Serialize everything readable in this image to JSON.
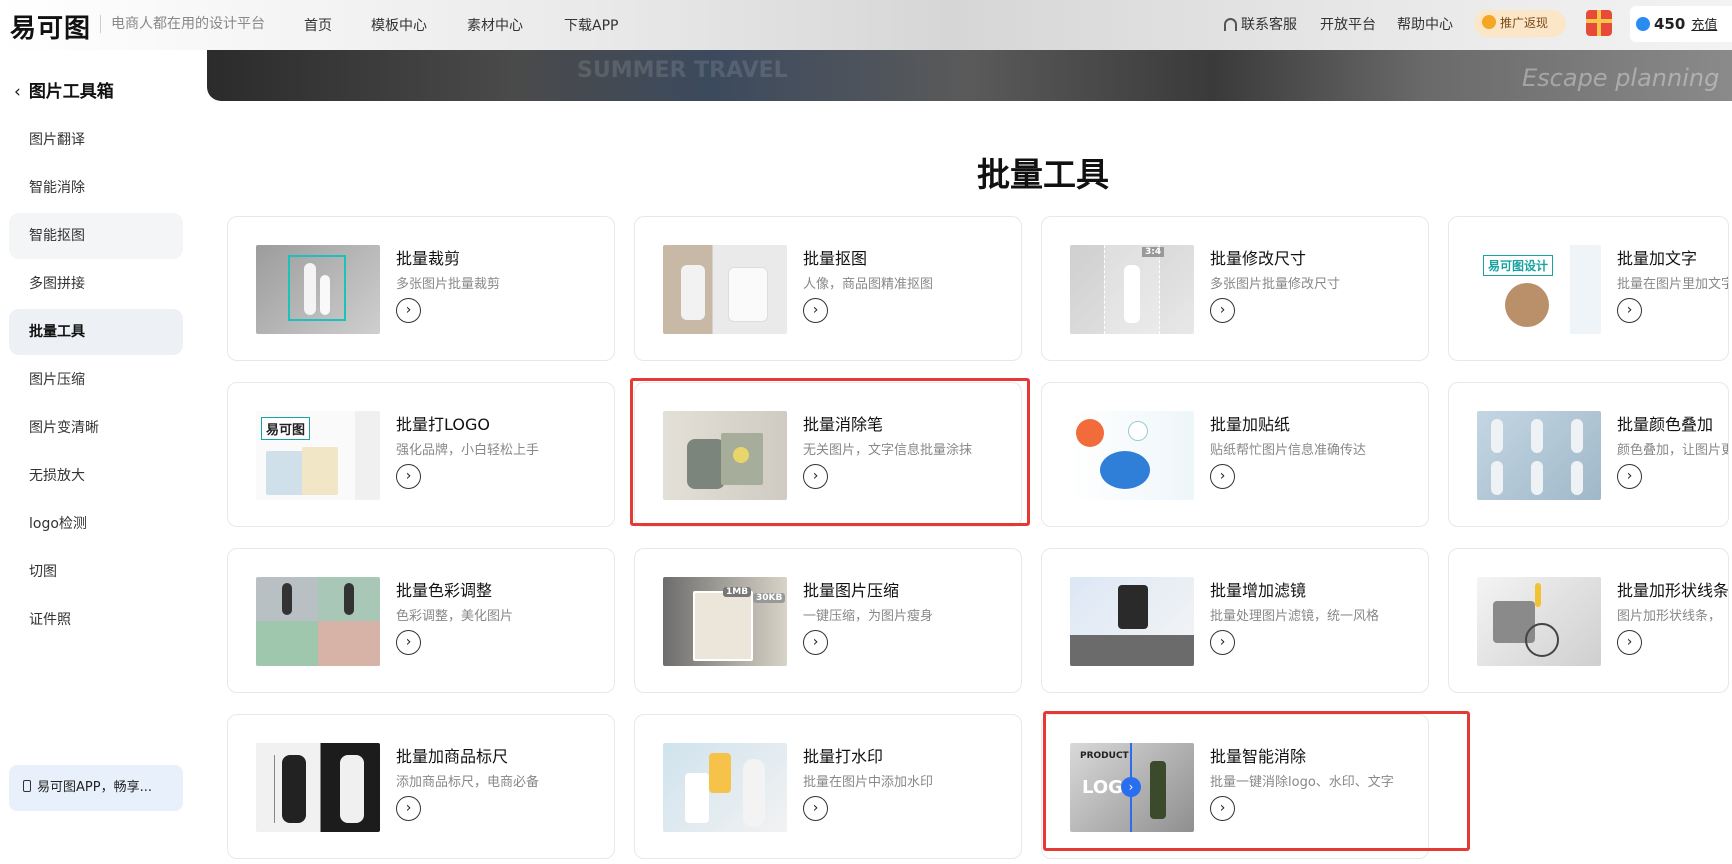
{
  "header": {
    "logo": "易可图",
    "slogan": "电商人都在用的设计平台",
    "nav": [
      "首页",
      "模板中心",
      "素材中心",
      "下载APP"
    ],
    "service": "联系客服",
    "open_platform": "开放平台",
    "help": "帮助中心",
    "promo": "推广返现",
    "balance": "450",
    "recharge": "充值"
  },
  "banner": {
    "texts": [
      "SUMMER TRAVEL",
      "Escape planning"
    ]
  },
  "sidebar": {
    "title": "图片工具箱",
    "items": [
      "图片翻译",
      "智能消除",
      "智能抠图",
      "多图拼接",
      "批量工具",
      "图片压缩",
      "图片变清晰",
      "无损放大",
      "logo检测",
      "切图",
      "证件照"
    ],
    "active_index": 4,
    "hover_index": 2,
    "app_promo": "易可图APP，畅享..."
  },
  "main": {
    "heading": "批量工具",
    "tools": [
      {
        "title": "批量裁剪",
        "desc": "多张图片批量裁剪",
        "highlighted": false
      },
      {
        "title": "批量抠图",
        "desc": "人像，商品图精准抠图",
        "highlighted": false
      },
      {
        "title": "批量修改尺寸",
        "desc": "多张图片批量修改尺寸",
        "highlighted": false
      },
      {
        "title": "批量加文字",
        "desc": "批量在图片里加文字",
        "highlighted": false
      },
      {
        "title": "批量打LOGO",
        "desc": "强化品牌，小白轻松上手",
        "highlighted": false
      },
      {
        "title": "批量消除笔",
        "desc": "无关图片，文字信息批量涂抹",
        "highlighted": true
      },
      {
        "title": "批量加贴纸",
        "desc": "贴纸帮忙图片信息准确传达",
        "highlighted": false
      },
      {
        "title": "批量颜色叠加",
        "desc": "颜色叠加，让图片更",
        "highlighted": false
      },
      {
        "title": "批量色彩调整",
        "desc": "色彩调整，美化图片",
        "highlighted": false
      },
      {
        "title": "批量图片压缩",
        "desc": "一键压缩，为图片瘦身",
        "highlighted": false
      },
      {
        "title": "批量增加滤镜",
        "desc": "批量处理图片滤镜，统一风格",
        "highlighted": false
      },
      {
        "title": "批量加形状线条",
        "desc": "图片加形状线条，",
        "highlighted": false
      },
      {
        "title": "批量加商品标尺",
        "desc": "添加商品标尺，电商必备",
        "highlighted": false
      },
      {
        "title": "批量打水印",
        "desc": "批量在图片中添加水印",
        "highlighted": false
      },
      {
        "title": "批量智能消除",
        "desc": "批量一键消除logo、水印、文字",
        "highlighted": true
      }
    ],
    "thumb_labels": {
      "size_badge": "3:4",
      "text_tag": "易可图设计",
      "logo_tag": "易可图",
      "compress_1": "1MB",
      "compress_2": "30KB",
      "erase_top": "PRODUCT",
      "erase_big": "LOGO"
    }
  },
  "colors": {
    "highlight": "#e53935",
    "active_bg": "#edf0f4",
    "accent_blue": "#2a6ef0"
  }
}
